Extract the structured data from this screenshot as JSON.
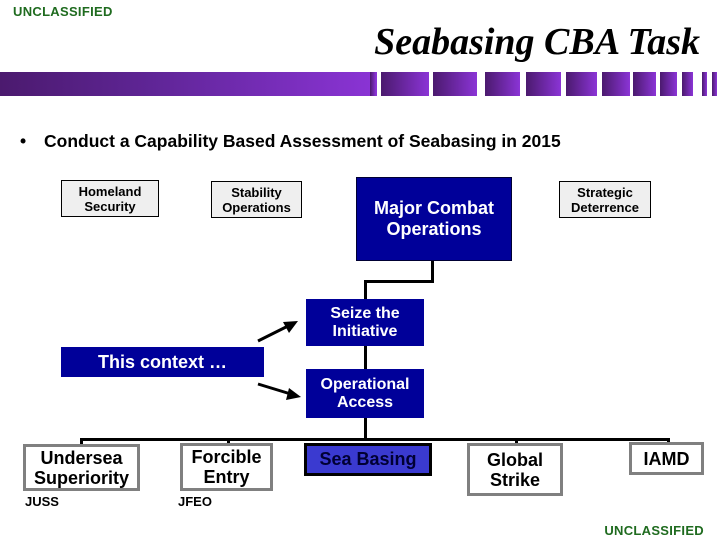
{
  "header": {
    "classification_top": "UNCLASSIFIED",
    "title": "Seabasing CBA Task"
  },
  "bullet": {
    "marker": "•",
    "text": "Conduct a Capability Based Assessment of Seabasing in 2015"
  },
  "mission_areas": [
    {
      "label": "Homeland Security",
      "line1": "Homeland",
      "line2": "Security"
    },
    {
      "label": "Stability Operations",
      "line1": "Stability",
      "line2": "Operations"
    },
    {
      "label": "Major Combat Operations",
      "line1": "Major Combat",
      "line2": "Operations"
    },
    {
      "label": "Strategic Deterrence",
      "line1": "Strategic",
      "line2": "Deterrence"
    }
  ],
  "chain": {
    "seize": {
      "line1": "Seize the",
      "line2": "Initiative"
    },
    "access": {
      "line1": "Operational",
      "line2": "Access"
    },
    "context": "This context …"
  },
  "capabilities": [
    {
      "line1": "Undersea",
      "line2": "Superiority",
      "sub": "JUSS"
    },
    {
      "line1": "Forcible",
      "line2": "Entry",
      "sub": "JFEO"
    },
    {
      "line1": "Sea Basing",
      "line2": "",
      "sub": ""
    },
    {
      "line1": "Global",
      "line2": "Strike",
      "sub": ""
    },
    {
      "line1": "IAMD",
      "line2": "",
      "sub": ""
    }
  ],
  "footer": {
    "classification_bottom": "UNCLASSIFIED"
  },
  "colors": {
    "classification": "#1f6b1f",
    "navy_box": "#000099",
    "sea_basing_box": "#3a3ad0",
    "bar_dark": "#4b1a6e",
    "bar_light": "#8b34d6"
  }
}
